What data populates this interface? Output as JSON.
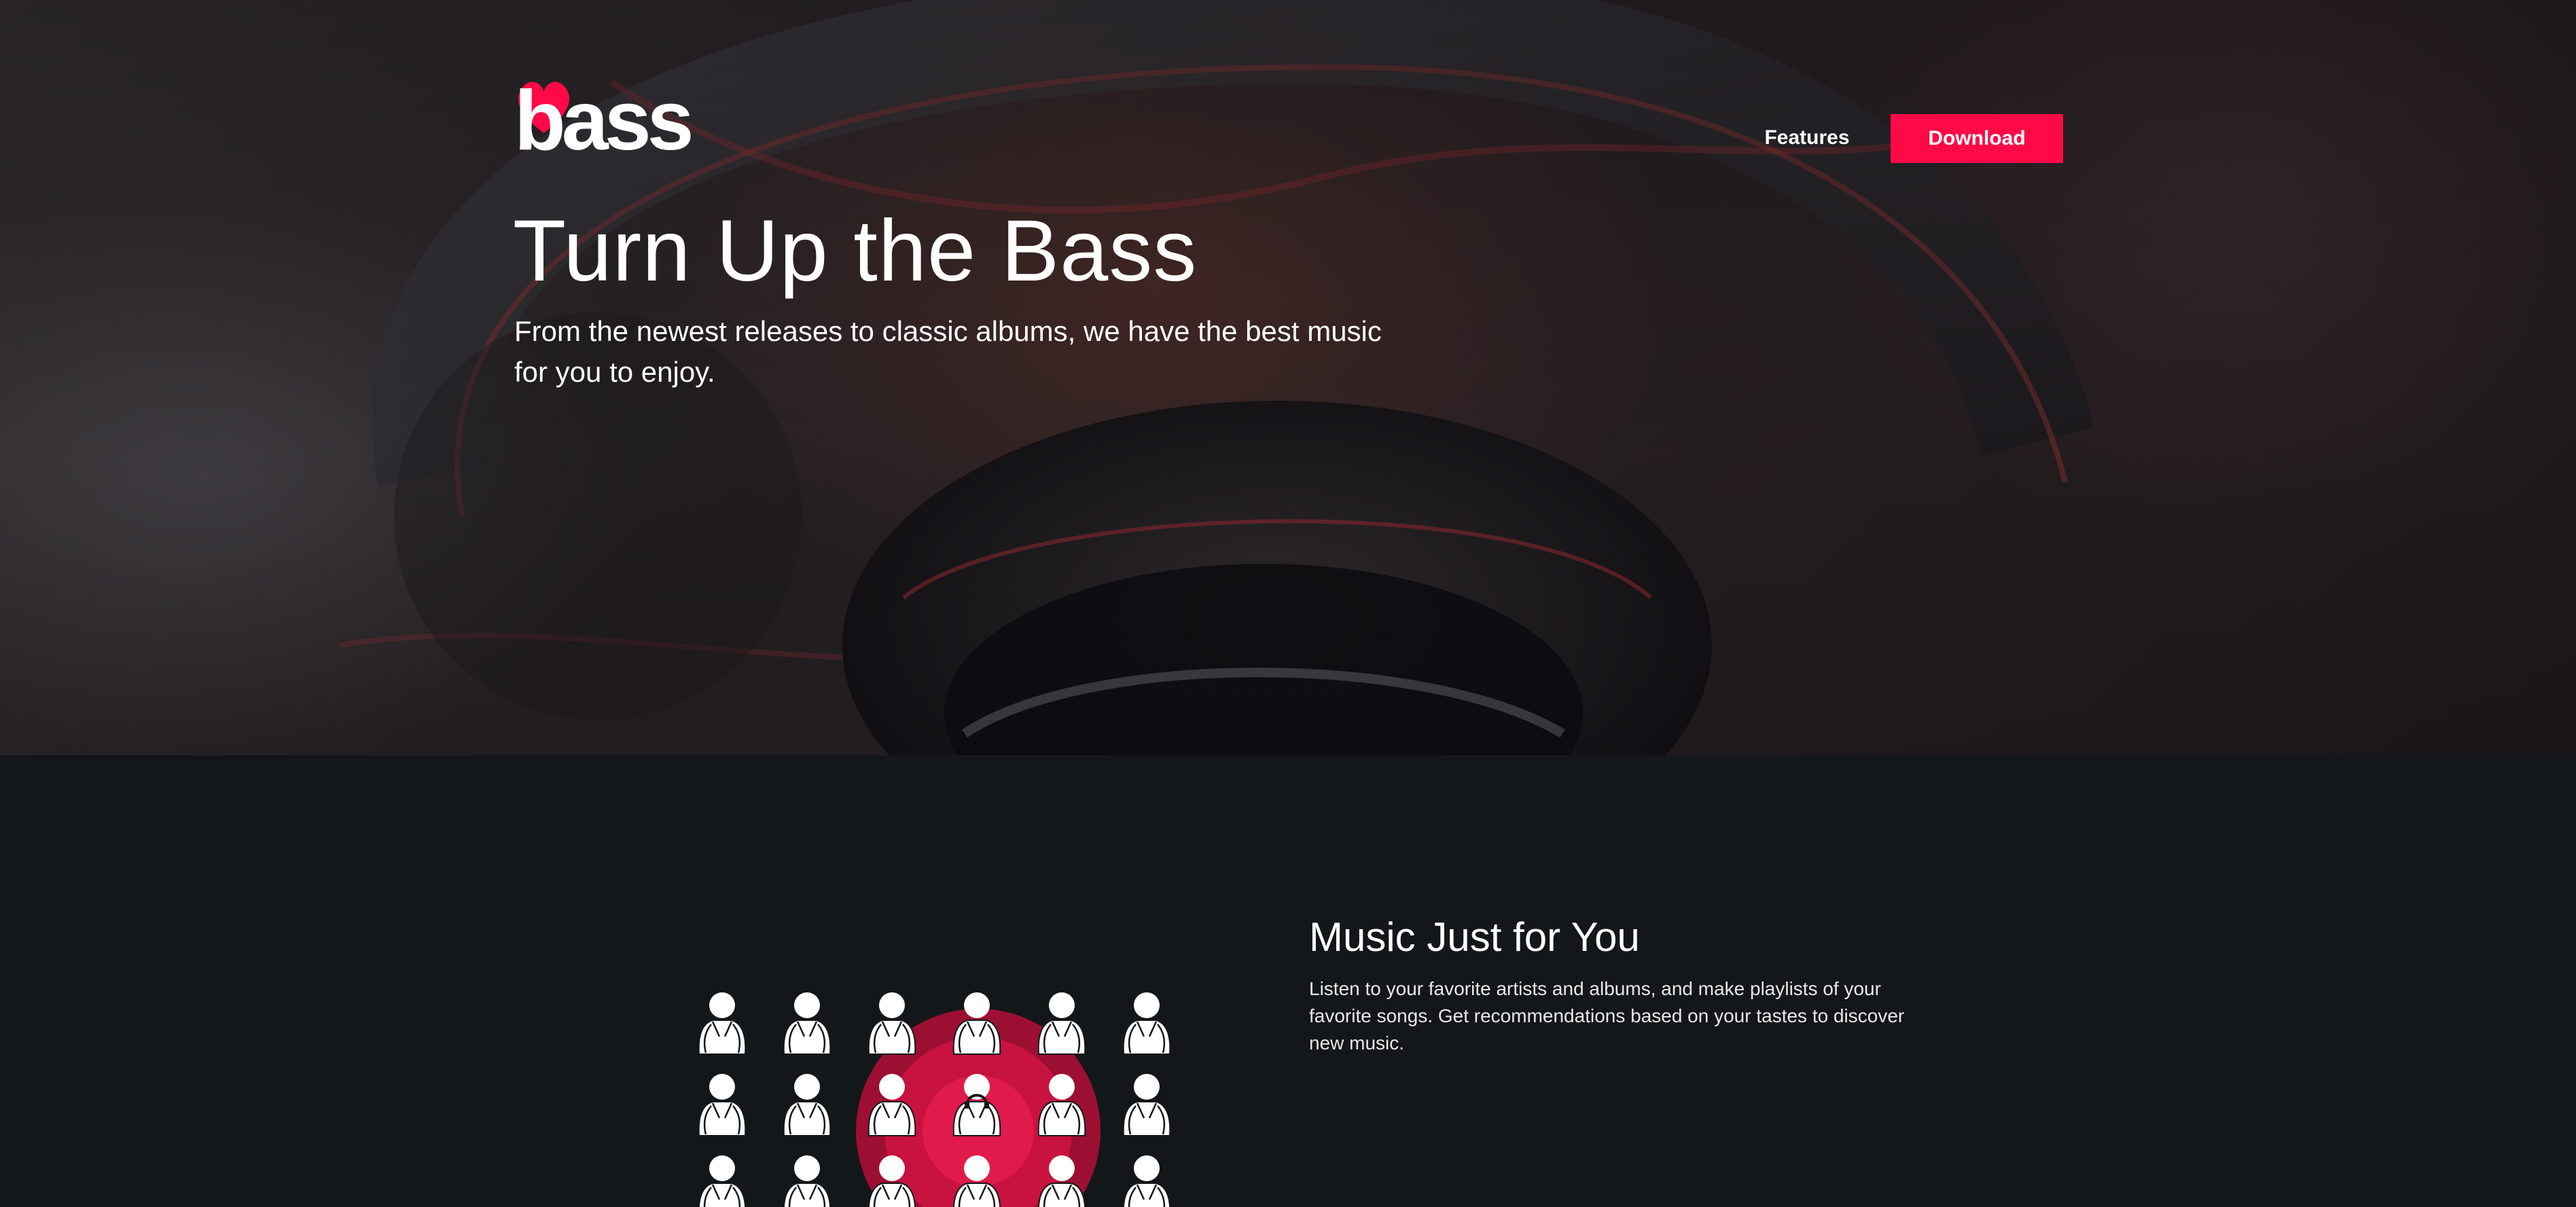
{
  "brand": {
    "logo_text": "bass",
    "accent_color": "#ff0a46"
  },
  "nav": {
    "features_label": "Features",
    "download_label": "Download"
  },
  "hero": {
    "title": "Turn Up the Bass",
    "subtitle": "From the newest releases to classic albums, we have the best music for you to enjoy."
  },
  "feature": {
    "title": "Music Just for You",
    "description": "Listen to your favorite artists and albums, and make playlists of your favorite songs. Get recommendations based on your tastes to discover new music.",
    "graphic_icon": "crowd-target-icon"
  },
  "colors": {
    "page_background": "#141719",
    "accent": "#ff0a46",
    "text": "#ffffff"
  }
}
